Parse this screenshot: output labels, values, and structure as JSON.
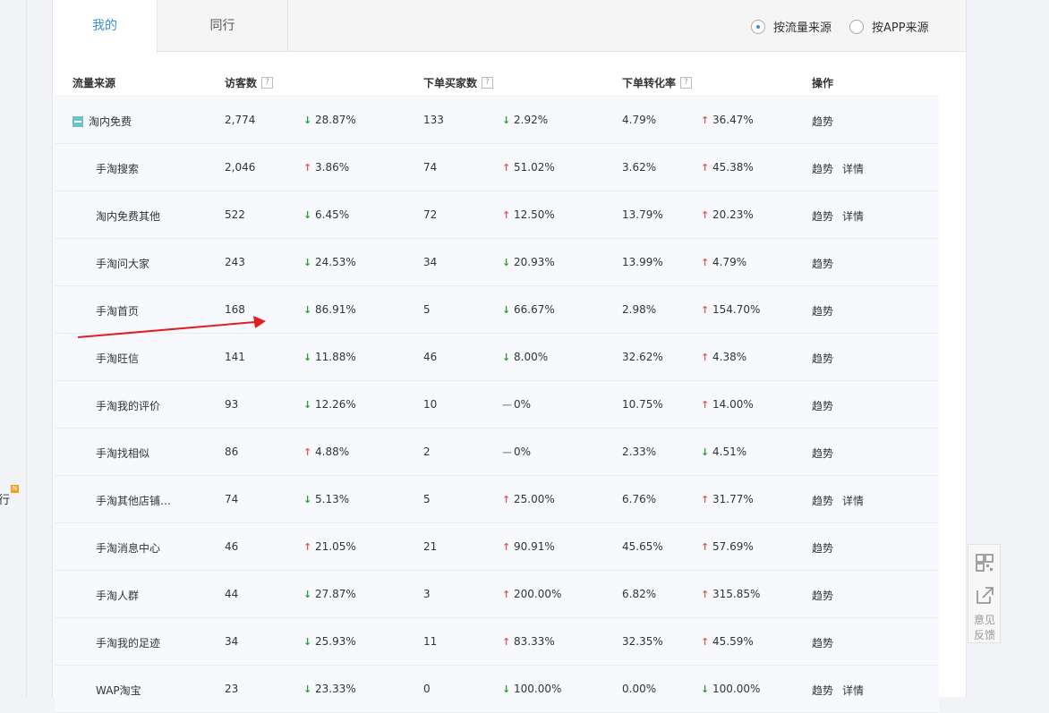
{
  "left_nav": {
    "badge": "N",
    "fragment": "行"
  },
  "tabs": [
    {
      "label": "我的",
      "active": true
    },
    {
      "label": "同行",
      "active": false
    }
  ],
  "source_toggle": {
    "options": [
      {
        "label": "按流量来源",
        "checked": true
      },
      {
        "label": "按APP来源",
        "checked": false
      }
    ]
  },
  "table": {
    "headers": {
      "source": "流量来源",
      "visitors": "访客数",
      "buyers": "下单买家数",
      "conversion": "下单转化率",
      "actions": "操作"
    },
    "help_glyph": "?",
    "rows": [
      {
        "name": "淘内免费",
        "parent": true,
        "visitors": "2,774",
        "visitors_dir": "down",
        "visitors_chg": "28.87%",
        "buyers": "133",
        "buyers_dir": "down",
        "buyers_chg": "2.92%",
        "rate": "4.79%",
        "rate_dir": "up",
        "rate_chg": "36.47%",
        "trend": "趋势",
        "detail": ""
      },
      {
        "name": "手淘搜索",
        "parent": false,
        "visitors": "2,046",
        "visitors_dir": "up",
        "visitors_chg": "3.86%",
        "buyers": "74",
        "buyers_dir": "up",
        "buyers_chg": "51.02%",
        "rate": "3.62%",
        "rate_dir": "up",
        "rate_chg": "45.38%",
        "trend": "趋势",
        "detail": "详情"
      },
      {
        "name": "淘内免费其他",
        "parent": false,
        "visitors": "522",
        "visitors_dir": "down",
        "visitors_chg": "6.45%",
        "buyers": "72",
        "buyers_dir": "up",
        "buyers_chg": "12.50%",
        "rate": "13.79%",
        "rate_dir": "up",
        "rate_chg": "20.23%",
        "trend": "趋势",
        "detail": "详情"
      },
      {
        "name": "手淘问大家",
        "parent": false,
        "visitors": "243",
        "visitors_dir": "down",
        "visitors_chg": "24.53%",
        "buyers": "34",
        "buyers_dir": "down",
        "buyers_chg": "20.93%",
        "rate": "13.99%",
        "rate_dir": "up",
        "rate_chg": "4.79%",
        "trend": "趋势",
        "detail": ""
      },
      {
        "name": "手淘首页",
        "parent": false,
        "visitors": "168",
        "visitors_dir": "down",
        "visitors_chg": "86.91%",
        "buyers": "5",
        "buyers_dir": "down",
        "buyers_chg": "66.67%",
        "rate": "2.98%",
        "rate_dir": "up",
        "rate_chg": "154.70%",
        "trend": "趋势",
        "detail": ""
      },
      {
        "name": "手淘旺信",
        "parent": false,
        "visitors": "141",
        "visitors_dir": "down",
        "visitors_chg": "11.88%",
        "buyers": "46",
        "buyers_dir": "down",
        "buyers_chg": "8.00%",
        "rate": "32.62%",
        "rate_dir": "up",
        "rate_chg": "4.38%",
        "trend": "趋势",
        "detail": ""
      },
      {
        "name": "手淘我的评价",
        "parent": false,
        "visitors": "93",
        "visitors_dir": "down",
        "visitors_chg": "12.26%",
        "buyers": "10",
        "buyers_dir": "flat",
        "buyers_chg": "0%",
        "rate": "10.75%",
        "rate_dir": "up",
        "rate_chg": "14.00%",
        "trend": "趋势",
        "detail": ""
      },
      {
        "name": "手淘找相似",
        "parent": false,
        "visitors": "86",
        "visitors_dir": "up",
        "visitors_chg": "4.88%",
        "buyers": "2",
        "buyers_dir": "flat",
        "buyers_chg": "0%",
        "rate": "2.33%",
        "rate_dir": "down",
        "rate_chg": "4.51%",
        "trend": "趋势",
        "detail": ""
      },
      {
        "name": "手淘其他店铺…",
        "parent": false,
        "visitors": "74",
        "visitors_dir": "down",
        "visitors_chg": "5.13%",
        "buyers": "5",
        "buyers_dir": "up",
        "buyers_chg": "25.00%",
        "rate": "6.76%",
        "rate_dir": "up",
        "rate_chg": "31.77%",
        "trend": "趋势",
        "detail": "详情"
      },
      {
        "name": "手淘消息中心",
        "parent": false,
        "visitors": "46",
        "visitors_dir": "up",
        "visitors_chg": "21.05%",
        "buyers": "21",
        "buyers_dir": "up",
        "buyers_chg": "90.91%",
        "rate": "45.65%",
        "rate_dir": "up",
        "rate_chg": "57.69%",
        "trend": "趋势",
        "detail": ""
      },
      {
        "name": "手淘人群",
        "parent": false,
        "visitors": "44",
        "visitors_dir": "down",
        "visitors_chg": "27.87%",
        "buyers": "3",
        "buyers_dir": "up",
        "buyers_chg": "200.00%",
        "rate": "6.82%",
        "rate_dir": "up",
        "rate_chg": "315.85%",
        "trend": "趋势",
        "detail": ""
      },
      {
        "name": "手淘我的足迹",
        "parent": false,
        "visitors": "34",
        "visitors_dir": "down",
        "visitors_chg": "25.93%",
        "buyers": "11",
        "buyers_dir": "up",
        "buyers_chg": "83.33%",
        "rate": "32.35%",
        "rate_dir": "up",
        "rate_chg": "45.59%",
        "trend": "趋势",
        "detail": ""
      },
      {
        "name": "WAP淘宝",
        "parent": false,
        "visitors": "23",
        "visitors_dir": "down",
        "visitors_chg": "23.33%",
        "buyers": "0",
        "buyers_dir": "down",
        "buyers_chg": "100.00%",
        "rate": "0.00%",
        "rate_dir": "down",
        "rate_chg": "100.00%",
        "trend": "趋势",
        "detail": "详情"
      }
    ]
  },
  "side_tools": {
    "qr_icon": "qr-code-icon",
    "share_icon": "share-icon",
    "feedback_line1": "意见",
    "feedback_line2": "反馈"
  },
  "colors": {
    "accent": "#3a8fd6",
    "up": "#e05a5a",
    "down": "#2aa02a",
    "flat": "#999999",
    "annotation_arrow": "#e02020"
  },
  "arrow_glyphs": {
    "up": "↑",
    "down": "↓",
    "flat": "—"
  }
}
